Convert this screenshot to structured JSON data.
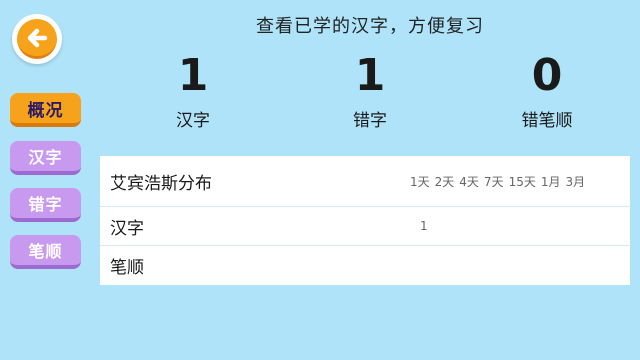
{
  "header": {
    "subtitle": "查看已学的汉字，方便复习"
  },
  "stats": [
    {
      "value": "1",
      "label": "汉字"
    },
    {
      "value": "1",
      "label": "错字"
    },
    {
      "value": "0",
      "label": "错笔顺"
    }
  ],
  "tabs": [
    {
      "label": "概况",
      "active": true
    },
    {
      "label": "汉字",
      "active": false
    },
    {
      "label": "错字",
      "active": false
    },
    {
      "label": "笔顺",
      "active": false
    }
  ],
  "table": {
    "header_label": "艾宾浩斯分布",
    "intervals": [
      "1天",
      "2天",
      "4天",
      "7天",
      "15天",
      "1月",
      "3月"
    ],
    "rows": [
      {
        "label": "汉字",
        "first_value": "1"
      },
      {
        "label": "笔顺",
        "first_value": ""
      }
    ]
  },
  "colors": {
    "background": "#aee3f9",
    "accent_orange": "#f7a21b",
    "tab_purple": "#c79af0"
  },
  "icons": {
    "back": "arrow-left-icon"
  }
}
